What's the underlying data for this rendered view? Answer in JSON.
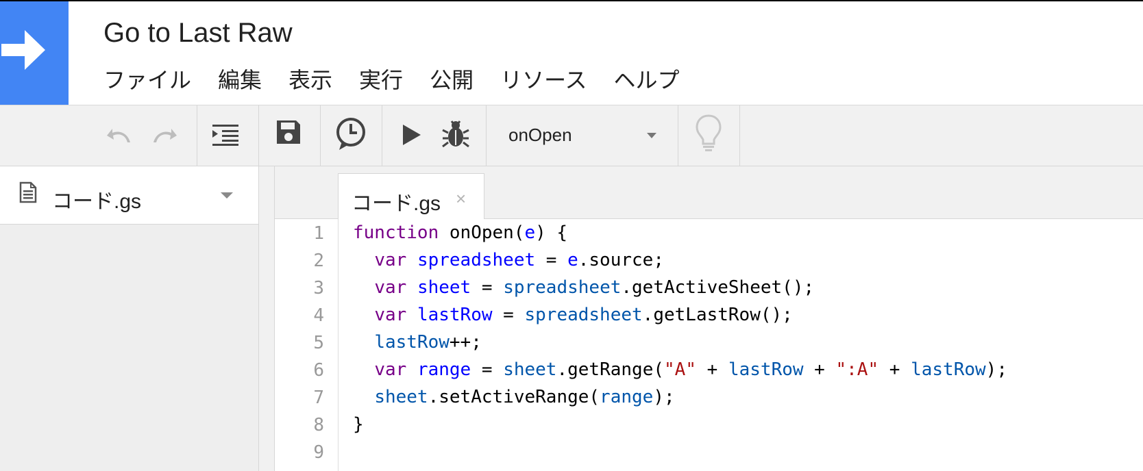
{
  "app": {
    "title": "Go to Last Raw",
    "brand_color": "#4285f4"
  },
  "menu": [
    "ファイル",
    "編集",
    "表示",
    "実行",
    "公開",
    "リソース",
    "ヘルプ"
  ],
  "toolbar": {
    "icons": [
      "undo-icon",
      "redo-icon",
      "indent-icon",
      "save-icon",
      "timer-trigger-icon",
      "run-icon",
      "debug-icon",
      "lightbulb-icon"
    ],
    "selected_function": "onOpen"
  },
  "sidebar": {
    "files": [
      {
        "name": "コード.gs",
        "icon": "document-icon"
      }
    ]
  },
  "editor": {
    "tab_label": "コード.gs",
    "tab_close": "×",
    "line_numbers": [
      "1",
      "2",
      "3",
      "4",
      "5",
      "6",
      "7",
      "8",
      "9"
    ],
    "lines": [
      [
        {
          "t": "function",
          "c": "kw"
        },
        {
          "t": " onOpen(",
          "c": ""
        },
        {
          "t": "e",
          "c": "def"
        },
        {
          "t": ") {",
          "c": ""
        }
      ],
      [
        {
          "t": "  ",
          "c": ""
        },
        {
          "t": "var",
          "c": "kw"
        },
        {
          "t": " ",
          "c": ""
        },
        {
          "t": "spreadsheet",
          "c": "def"
        },
        {
          "t": " = ",
          "c": ""
        },
        {
          "t": "e",
          "c": "def"
        },
        {
          "t": ".source;",
          "c": ""
        }
      ],
      [
        {
          "t": "  ",
          "c": ""
        },
        {
          "t": "var",
          "c": "kw"
        },
        {
          "t": " ",
          "c": ""
        },
        {
          "t": "sheet",
          "c": "def"
        },
        {
          "t": " = ",
          "c": ""
        },
        {
          "t": "spreadsheet",
          "c": "var"
        },
        {
          "t": ".getActiveSheet();",
          "c": ""
        }
      ],
      [
        {
          "t": "  ",
          "c": ""
        },
        {
          "t": "var",
          "c": "kw"
        },
        {
          "t": " ",
          "c": ""
        },
        {
          "t": "lastRow",
          "c": "def"
        },
        {
          "t": " = ",
          "c": ""
        },
        {
          "t": "spreadsheet",
          "c": "var"
        },
        {
          "t": ".getLastRow();",
          "c": ""
        }
      ],
      [
        {
          "t": "  ",
          "c": ""
        },
        {
          "t": "lastRow",
          "c": "var"
        },
        {
          "t": "++;",
          "c": ""
        }
      ],
      [
        {
          "t": "  ",
          "c": ""
        },
        {
          "t": "var",
          "c": "kw"
        },
        {
          "t": " ",
          "c": ""
        },
        {
          "t": "range",
          "c": "def"
        },
        {
          "t": " = ",
          "c": ""
        },
        {
          "t": "sheet",
          "c": "var"
        },
        {
          "t": ".getRange(",
          "c": ""
        },
        {
          "t": "\"A\"",
          "c": "str"
        },
        {
          "t": " + ",
          "c": ""
        },
        {
          "t": "lastRow",
          "c": "var"
        },
        {
          "t": " + ",
          "c": ""
        },
        {
          "t": "\":A\"",
          "c": "str"
        },
        {
          "t": " + ",
          "c": ""
        },
        {
          "t": "lastRow",
          "c": "var"
        },
        {
          "t": ");",
          "c": ""
        }
      ],
      [
        {
          "t": "  ",
          "c": ""
        },
        {
          "t": "sheet",
          "c": "var"
        },
        {
          "t": ".setActiveRange(",
          "c": ""
        },
        {
          "t": "range",
          "c": "var"
        },
        {
          "t": ");",
          "c": ""
        }
      ],
      [
        {
          "t": "}",
          "c": ""
        }
      ]
    ]
  }
}
